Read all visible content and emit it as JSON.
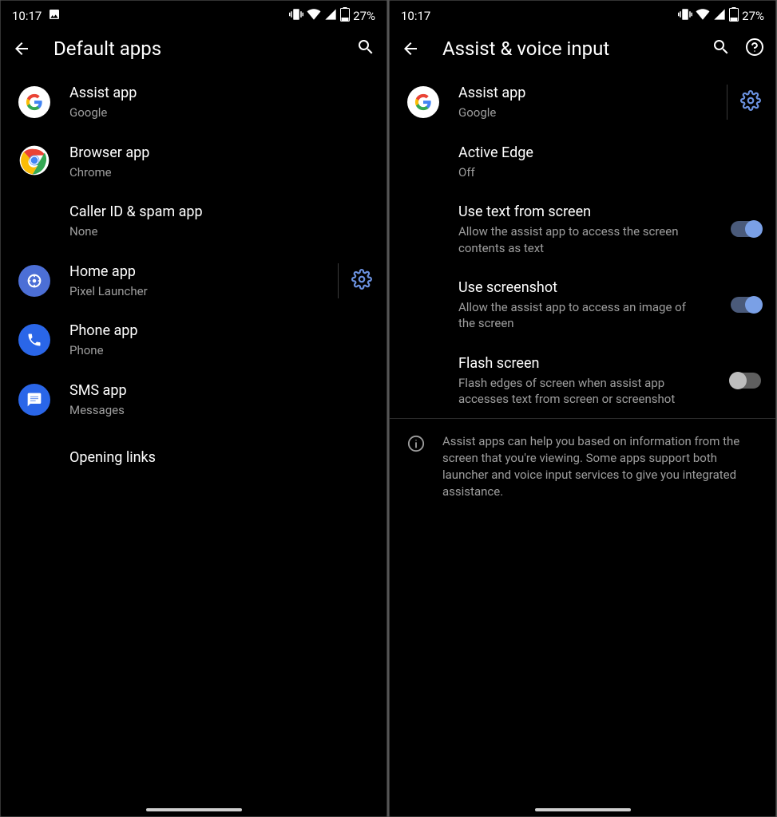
{
  "status": {
    "time": "10:17",
    "battery_pct": "27%"
  },
  "left": {
    "title": "Default apps",
    "items": [
      {
        "title": "Assist app",
        "sub": "Google"
      },
      {
        "title": "Browser app",
        "sub": "Chrome"
      },
      {
        "title": "Caller ID & spam app",
        "sub": "None"
      },
      {
        "title": "Home app",
        "sub": "Pixel Launcher"
      },
      {
        "title": "Phone app",
        "sub": "Phone"
      },
      {
        "title": "SMS app",
        "sub": "Messages"
      },
      {
        "title": "Opening links"
      }
    ]
  },
  "right": {
    "title": "Assist & voice input",
    "assist": {
      "title": "Assist app",
      "sub": "Google"
    },
    "active_edge": {
      "title": "Active Edge",
      "sub": "Off"
    },
    "use_text": {
      "title": "Use text from screen",
      "sub": "Allow the assist app to access the screen contents as text",
      "on": true
    },
    "use_screenshot": {
      "title": "Use screenshot",
      "sub": "Allow the assist app to access an image of the screen",
      "on": true
    },
    "flash": {
      "title": "Flash screen",
      "sub": "Flash edges of screen when assist app accesses text from screen or screenshot",
      "on": false
    },
    "info": "Assist apps can help you based on information from the screen that you're viewing. Some apps support both launcher and voice input services to give you integrated assistance."
  },
  "colors": {
    "accent": "#6b92e0",
    "subtext": "#9e9e9e"
  }
}
